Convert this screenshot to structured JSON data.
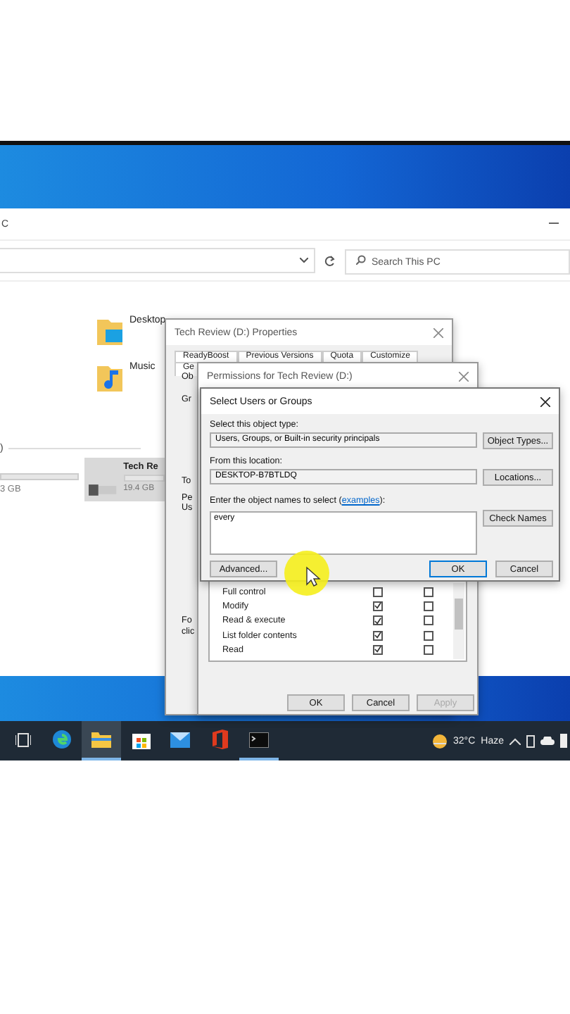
{
  "explorer": {
    "title": "C",
    "search": {
      "placeholder": "Search This PC"
    },
    "folders": [
      {
        "name": "Desktop",
        "kind": "desktop"
      },
      {
        "name": "Music",
        "kind": "music"
      }
    ],
    "section": ")",
    "drives": [
      {
        "size": "3 GB",
        "selected": false
      },
      {
        "name": "Tech Re",
        "size": "19.4 GB",
        "selected": true
      }
    ]
  },
  "properties": {
    "title": "Tech Review (D:) Properties",
    "tab_rows": [
      [
        "ReadyBoost",
        "Previous Versions",
        "Quota",
        "Customize"
      ],
      [
        "Ge"
      ]
    ],
    "fragments": [
      "Ob",
      "Gr",
      "To",
      "Pe",
      "Us",
      "Fo",
      "clic"
    ]
  },
  "permissions": {
    "title": "Permissions for Tech Review (D:)",
    "rows": [
      {
        "label": "Full control",
        "allow": false,
        "deny": false
      },
      {
        "label": "Modify",
        "allow": true,
        "deny": false
      },
      {
        "label": "Read & execute",
        "allow": true,
        "deny": false
      },
      {
        "label": "List folder contents",
        "allow": true,
        "deny": false
      },
      {
        "label": "Read",
        "allow": true,
        "deny": false
      }
    ],
    "buttons": [
      {
        "label": "OK",
        "disabled": false
      },
      {
        "label": "Cancel",
        "disabled": false
      },
      {
        "label": "Apply",
        "disabled": true
      }
    ]
  },
  "select_users": {
    "title": "Select Users or Groups",
    "object_type_label": "Select this object type:",
    "object_type": "Users, Groups, or Built-in security principals",
    "object_types_button": "Object Types...",
    "location_label": "From this location:",
    "location": "DESKTOP-B7BTLDQ",
    "locations_button": "Locations...",
    "names_label": "Enter the object names to select (",
    "names_link": "examples",
    "names_label_end": "):",
    "names_value": "every",
    "check_names_button": "Check Names",
    "advanced_button": "Advanced...",
    "ok_button": "OK",
    "cancel_button": "Cancel"
  },
  "taskbar": {
    "apps": [
      {
        "kind": "taskview",
        "active": false,
        "open": false
      },
      {
        "kind": "edge",
        "active": false,
        "open": false
      },
      {
        "kind": "explorer",
        "active": true,
        "open": true
      },
      {
        "kind": "store",
        "active": false,
        "open": false
      },
      {
        "kind": "mail",
        "active": false,
        "open": false
      },
      {
        "kind": "office",
        "active": false,
        "open": false
      },
      {
        "kind": "terminal",
        "active": false,
        "open": true
      }
    ],
    "temperature": "32°C",
    "weather": "Haze"
  }
}
